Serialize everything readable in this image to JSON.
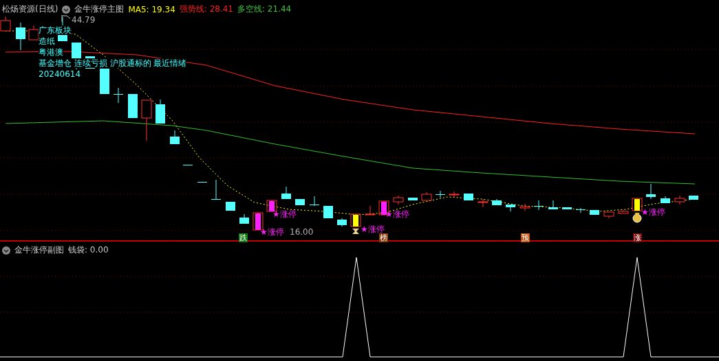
{
  "main_panel": {
    "stock": "松炀资源(日线)",
    "indicator": "金牛涨停主图",
    "legend": [
      {
        "label": "MA5: 19.34",
        "color": "#ffff00"
      },
      {
        "label": "强势线: 28.41",
        "color": "#ff2020"
      },
      {
        "label": "多空线: 21.44",
        "color": "#40c040"
      }
    ],
    "high_label": "44.79",
    "low_label": "16.00",
    "notes": [
      "广东板块",
      "造纸",
      "粤港澳",
      "基金增仓 连续亏损 沪股通标的 最近情绪",
      "20240614"
    ],
    "limit_up_labels": [
      "★涨停",
      "★涨停",
      "★涨停",
      "★涨停",
      "★涨停"
    ],
    "signals": [
      {
        "text": "跌",
        "color": "#107a10"
      },
      {
        "text": "榜",
        "color": "#8a3c0c"
      },
      {
        "text": "预",
        "color": "#c0500c"
      },
      {
        "text": "涨",
        "color": "#7a0a0a"
      }
    ]
  },
  "sub_panel": {
    "indicator": "金牛涨停副图",
    "legend": "钱袋: 0.00"
  }
}
